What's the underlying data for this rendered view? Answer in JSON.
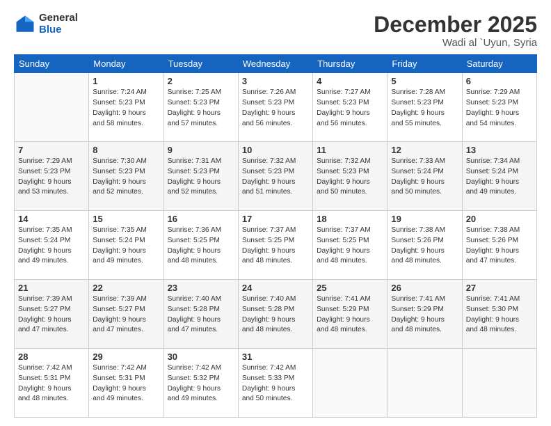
{
  "header": {
    "logo_general": "General",
    "logo_blue": "Blue",
    "month_title": "December 2025",
    "location": "Wadi al `Uyun, Syria"
  },
  "days_of_week": [
    "Sunday",
    "Monday",
    "Tuesday",
    "Wednesday",
    "Thursday",
    "Friday",
    "Saturday"
  ],
  "weeks": [
    [
      {
        "day": "",
        "info": ""
      },
      {
        "day": "1",
        "info": "Sunrise: 7:24 AM\nSunset: 5:23 PM\nDaylight: 9 hours\nand 58 minutes."
      },
      {
        "day": "2",
        "info": "Sunrise: 7:25 AM\nSunset: 5:23 PM\nDaylight: 9 hours\nand 57 minutes."
      },
      {
        "day": "3",
        "info": "Sunrise: 7:26 AM\nSunset: 5:23 PM\nDaylight: 9 hours\nand 56 minutes."
      },
      {
        "day": "4",
        "info": "Sunrise: 7:27 AM\nSunset: 5:23 PM\nDaylight: 9 hours\nand 56 minutes."
      },
      {
        "day": "5",
        "info": "Sunrise: 7:28 AM\nSunset: 5:23 PM\nDaylight: 9 hours\nand 55 minutes."
      },
      {
        "day": "6",
        "info": "Sunrise: 7:29 AM\nSunset: 5:23 PM\nDaylight: 9 hours\nand 54 minutes."
      }
    ],
    [
      {
        "day": "7",
        "info": "Sunrise: 7:29 AM\nSunset: 5:23 PM\nDaylight: 9 hours\nand 53 minutes."
      },
      {
        "day": "8",
        "info": "Sunrise: 7:30 AM\nSunset: 5:23 PM\nDaylight: 9 hours\nand 52 minutes."
      },
      {
        "day": "9",
        "info": "Sunrise: 7:31 AM\nSunset: 5:23 PM\nDaylight: 9 hours\nand 52 minutes."
      },
      {
        "day": "10",
        "info": "Sunrise: 7:32 AM\nSunset: 5:23 PM\nDaylight: 9 hours\nand 51 minutes."
      },
      {
        "day": "11",
        "info": "Sunrise: 7:32 AM\nSunset: 5:23 PM\nDaylight: 9 hours\nand 50 minutes."
      },
      {
        "day": "12",
        "info": "Sunrise: 7:33 AM\nSunset: 5:24 PM\nDaylight: 9 hours\nand 50 minutes."
      },
      {
        "day": "13",
        "info": "Sunrise: 7:34 AM\nSunset: 5:24 PM\nDaylight: 9 hours\nand 49 minutes."
      }
    ],
    [
      {
        "day": "14",
        "info": "Sunrise: 7:35 AM\nSunset: 5:24 PM\nDaylight: 9 hours\nand 49 minutes."
      },
      {
        "day": "15",
        "info": "Sunrise: 7:35 AM\nSunset: 5:24 PM\nDaylight: 9 hours\nand 49 minutes."
      },
      {
        "day": "16",
        "info": "Sunrise: 7:36 AM\nSunset: 5:25 PM\nDaylight: 9 hours\nand 48 minutes."
      },
      {
        "day": "17",
        "info": "Sunrise: 7:37 AM\nSunset: 5:25 PM\nDaylight: 9 hours\nand 48 minutes."
      },
      {
        "day": "18",
        "info": "Sunrise: 7:37 AM\nSunset: 5:25 PM\nDaylight: 9 hours\nand 48 minutes."
      },
      {
        "day": "19",
        "info": "Sunrise: 7:38 AM\nSunset: 5:26 PM\nDaylight: 9 hours\nand 48 minutes."
      },
      {
        "day": "20",
        "info": "Sunrise: 7:38 AM\nSunset: 5:26 PM\nDaylight: 9 hours\nand 47 minutes."
      }
    ],
    [
      {
        "day": "21",
        "info": "Sunrise: 7:39 AM\nSunset: 5:27 PM\nDaylight: 9 hours\nand 47 minutes."
      },
      {
        "day": "22",
        "info": "Sunrise: 7:39 AM\nSunset: 5:27 PM\nDaylight: 9 hours\nand 47 minutes."
      },
      {
        "day": "23",
        "info": "Sunrise: 7:40 AM\nSunset: 5:28 PM\nDaylight: 9 hours\nand 47 minutes."
      },
      {
        "day": "24",
        "info": "Sunrise: 7:40 AM\nSunset: 5:28 PM\nDaylight: 9 hours\nand 48 minutes."
      },
      {
        "day": "25",
        "info": "Sunrise: 7:41 AM\nSunset: 5:29 PM\nDaylight: 9 hours\nand 48 minutes."
      },
      {
        "day": "26",
        "info": "Sunrise: 7:41 AM\nSunset: 5:29 PM\nDaylight: 9 hours\nand 48 minutes."
      },
      {
        "day": "27",
        "info": "Sunrise: 7:41 AM\nSunset: 5:30 PM\nDaylight: 9 hours\nand 48 minutes."
      }
    ],
    [
      {
        "day": "28",
        "info": "Sunrise: 7:42 AM\nSunset: 5:31 PM\nDaylight: 9 hours\nand 48 minutes."
      },
      {
        "day": "29",
        "info": "Sunrise: 7:42 AM\nSunset: 5:31 PM\nDaylight: 9 hours\nand 49 minutes."
      },
      {
        "day": "30",
        "info": "Sunrise: 7:42 AM\nSunset: 5:32 PM\nDaylight: 9 hours\nand 49 minutes."
      },
      {
        "day": "31",
        "info": "Sunrise: 7:42 AM\nSunset: 5:33 PM\nDaylight: 9 hours\nand 50 minutes."
      },
      {
        "day": "",
        "info": ""
      },
      {
        "day": "",
        "info": ""
      },
      {
        "day": "",
        "info": ""
      }
    ]
  ]
}
